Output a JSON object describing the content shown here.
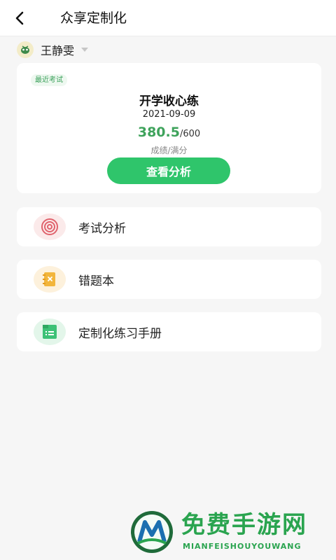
{
  "header": {
    "back_icon": "chevron-left-icon",
    "title": "众享定制化"
  },
  "user": {
    "avatar_icon": "cartoon-avatar-icon",
    "name": "王静雯",
    "dropdown_icon": "caret-down-icon"
  },
  "exam_card": {
    "badge": "最近考试",
    "title": "开学收心练",
    "date": "2021-09-09",
    "score": "380.5",
    "total": "/600",
    "caption": "成绩/满分",
    "button_label": "查看分析",
    "button_color": "#2fc56b"
  },
  "menu": {
    "items": [
      {
        "label": "考试分析",
        "icon": "target-icon",
        "icon_bg": "#fbeaea",
        "icon_color": "#e0636d"
      },
      {
        "label": "错题本",
        "icon": "notebook-icon",
        "icon_bg": "#fdf1dc",
        "icon_color": "#f2b53b"
      },
      {
        "label": "定制化练习手册",
        "icon": "booklet-icon",
        "icon_bg": "#e3f6ea",
        "icon_color": "#3cc176"
      }
    ]
  },
  "watermark": {
    "title": "免费手游网",
    "subtitle": "MIANFEISHOUYOUWANG",
    "logo_icon": "watermark-logo-icon"
  },
  "colors": {
    "accent": "#2fc56b",
    "score": "#3fa35c",
    "background": "#f6f6f6"
  }
}
